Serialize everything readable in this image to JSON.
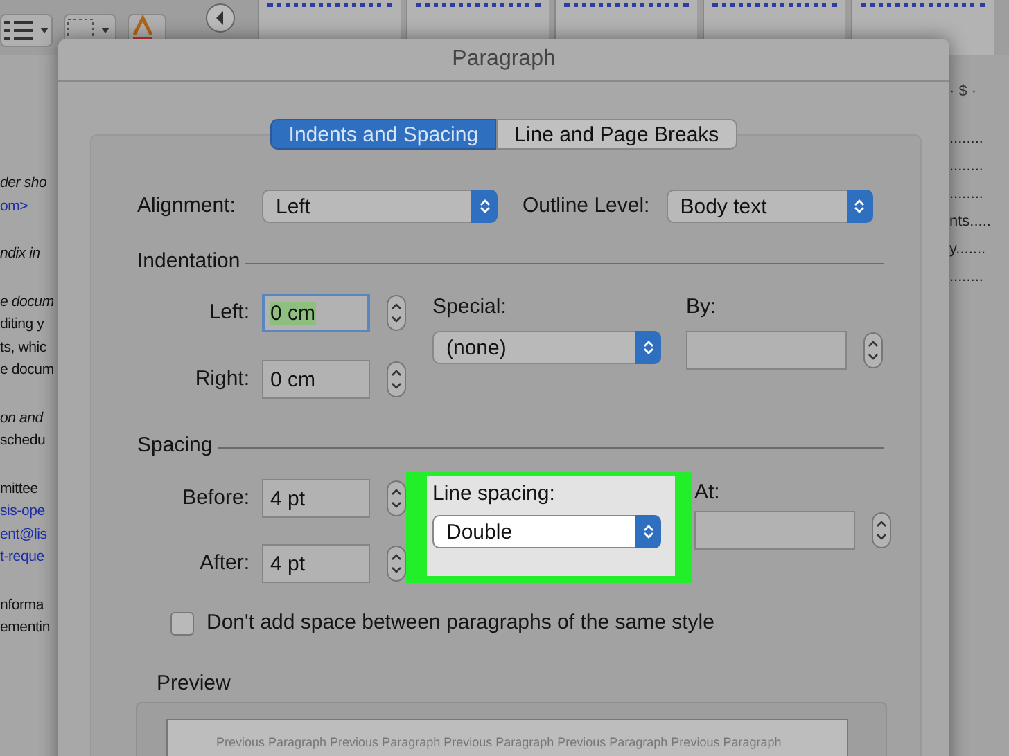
{
  "document": {
    "left_paragraphs": [
      [
        {
          "text": "der sho",
          "kind": "italic"
        },
        {
          "text": "om>",
          "kind": "link"
        }
      ],
      [
        {
          "text": "ndix in",
          "kind": "italic"
        }
      ],
      [
        {
          "text": "e docum",
          "kind": "italic"
        },
        {
          "text": "diting y",
          "kind": "plain"
        },
        {
          "text": "ts, whic",
          "kind": "plain"
        },
        {
          "text": "e docum",
          "kind": "plain"
        }
      ],
      [
        {
          "text": "on and",
          "kind": "italic"
        },
        {
          "text": "schedu",
          "kind": "plain"
        }
      ],
      [
        {
          "text": "mittee",
          "kind": "plain"
        },
        {
          "text": "sis-ope",
          "kind": "link"
        },
        {
          "text": "ent@lis",
          "kind": "link"
        },
        {
          "text": "t-reque",
          "kind": "link"
        }
      ],
      [
        {
          "text": "nforma",
          "kind": "plain"
        },
        {
          "text": "ementin",
          "kind": "plain"
        }
      ]
    ],
    "ruler_text": "· $ ·",
    "right_lines": [
      "........",
      "........",
      "........",
      "nts.....",
      "y.......",
      "........"
    ]
  },
  "dialog": {
    "title": "Paragraph",
    "tabs": [
      {
        "label": "Indents and Spacing",
        "selected": true
      },
      {
        "label": "Line and Page Breaks",
        "selected": false
      }
    ],
    "alignment": {
      "label": "Alignment:",
      "value": "Left"
    },
    "outline_level": {
      "label": "Outline Level:",
      "value": "Body text"
    },
    "indentation": {
      "heading": "Indentation",
      "left": {
        "label": "Left:",
        "value": "0 cm",
        "focused": true
      },
      "right": {
        "label": "Right:",
        "value": "0 cm",
        "focused": false
      },
      "special": {
        "label": "Special:",
        "value": "(none)"
      },
      "by": {
        "label": "By:"
      }
    },
    "spacing": {
      "heading": "Spacing",
      "before": {
        "label": "Before:",
        "value": "4 pt",
        "focused": false
      },
      "after": {
        "label": "After:",
        "value": "4 pt",
        "focused": false
      },
      "line_spacing": {
        "label": "Line spacing:",
        "value": "Double",
        "highlighted": true
      },
      "at": {
        "label": "At:"
      }
    },
    "same_style_checkbox": {
      "label": "Don't add space between paragraphs of the same style",
      "checked": false
    },
    "preview": {
      "label": "Preview",
      "sample_text": "Previous Paragraph Previous Paragraph Previous Paragraph Previous Paragraph Previous Paragraph"
    }
  }
}
